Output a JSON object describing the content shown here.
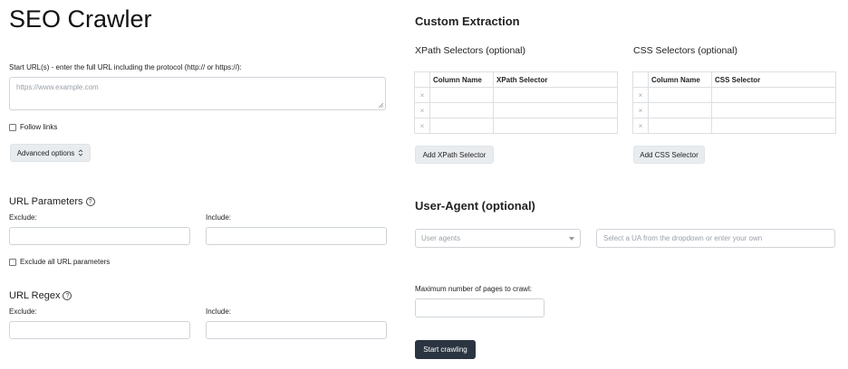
{
  "page": {
    "title": "SEO Crawler"
  },
  "start_urls": {
    "label": "Start URL(s) - enter the full URL including the protocol (http:// or https://):",
    "placeholder": "https://www.example.com"
  },
  "follow_links": {
    "label": "Follow links"
  },
  "advanced": {
    "label": "Advanced options",
    "icon": "chevron-updown-icon"
  },
  "url_parameters": {
    "heading": "URL Parameters",
    "exclude_label": "Exclude:",
    "include_label": "Include:",
    "exclude_all_label": "Exclude all URL parameters"
  },
  "url_regex": {
    "heading": "URL Regex",
    "exclude_label": "Exclude:",
    "include_label": "Include:"
  },
  "custom_extraction": {
    "heading": "Custom Extraction",
    "xpath": {
      "heading": "XPath Selectors (optional)",
      "columns": [
        "Column Name",
        "XPath Selector"
      ],
      "row_delete_icon": "×",
      "add_label": "Add XPath Selector"
    },
    "css": {
      "heading": "CSS Selectors (optional)",
      "columns": [
        "Column Name",
        "CSS Selector"
      ],
      "row_delete_icon": "×",
      "add_label": "Add CSS Selector"
    }
  },
  "user_agent": {
    "heading": "User-Agent (optional)",
    "select_placeholder": "User agents",
    "input_placeholder": "Select a UA from the dropdown or enter your own"
  },
  "max_pages": {
    "label": "Maximum number of pages to crawl:"
  },
  "start_button": {
    "label": "Start crawling"
  },
  "help_icon": "?"
}
